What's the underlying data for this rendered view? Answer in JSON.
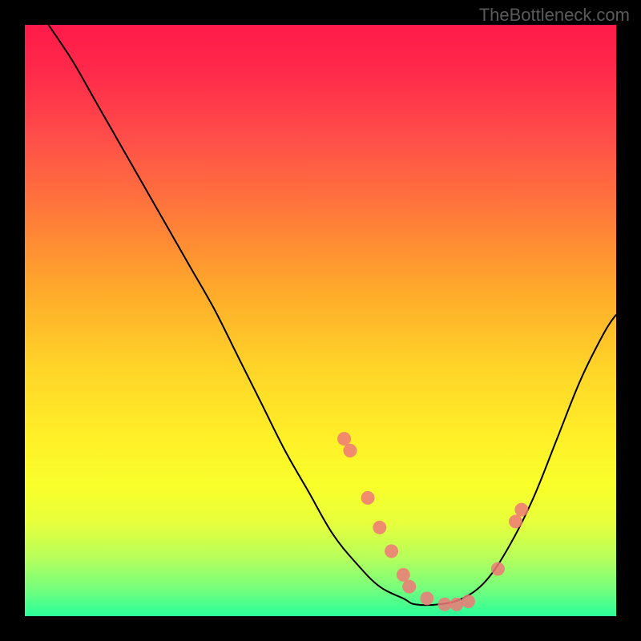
{
  "watermark": "TheBottleneck.com",
  "chart_data": {
    "type": "line",
    "title": "",
    "xlabel": "",
    "ylabel": "",
    "xlim": [
      0,
      100
    ],
    "ylim": [
      0,
      100
    ],
    "curve": {
      "x": [
        4,
        8,
        12,
        16,
        20,
        24,
        28,
        32,
        36,
        40,
        44,
        48,
        52,
        56,
        60,
        64,
        66,
        70,
        74,
        78,
        82,
        86,
        90,
        94,
        98,
        100
      ],
      "y": [
        100,
        94,
        87,
        80,
        73,
        66,
        59,
        52,
        44,
        36,
        28,
        21,
        14,
        9,
        5,
        3,
        2,
        2,
        3,
        6,
        12,
        20,
        30,
        40,
        48,
        51
      ]
    },
    "series": [
      {
        "name": "points",
        "x": [
          54,
          55,
          58,
          60,
          62,
          64,
          65,
          68,
          71,
          73,
          75,
          80,
          83,
          84
        ],
        "y": [
          30,
          28,
          20,
          15,
          11,
          7,
          5,
          3,
          2,
          2,
          2.5,
          8,
          16,
          18
        ]
      }
    ]
  }
}
